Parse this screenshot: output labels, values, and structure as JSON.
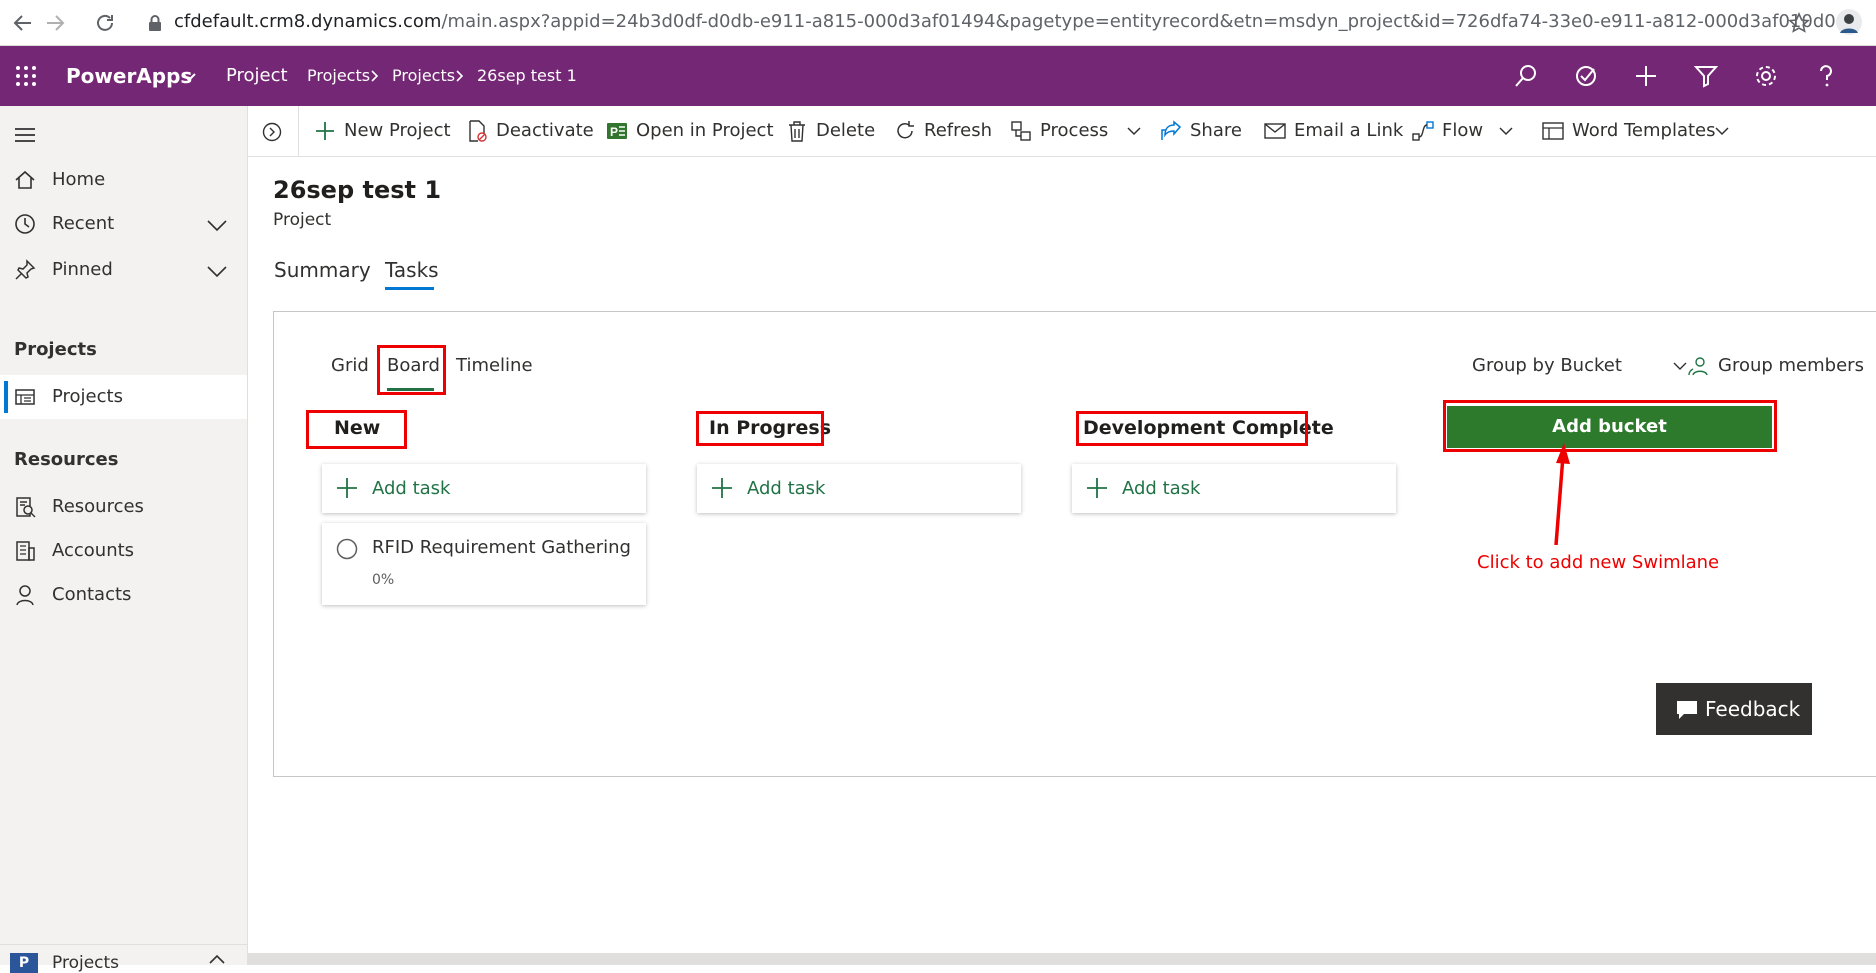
{
  "browser": {
    "url_domain": "cfdefault.crm8.dynamics.com",
    "url_path": "/main.aspx?appid=24b3d0df-d0db-e911-a815-000d3af01494&pagetype=entityrecord&etn=msdyn_project&id=726dfa74-33e0-e911-a812-000d3af010d0"
  },
  "topbar": {
    "app_name": "PowerApps",
    "module": "Project",
    "breadcrumb": [
      "Projects",
      "Projects",
      "26sep test 1"
    ],
    "icons": [
      "search-icon",
      "task-check-icon",
      "plus-icon",
      "filter-icon",
      "gear-icon",
      "help-icon"
    ]
  },
  "sidebar": {
    "items": [
      {
        "label": "Home",
        "icon": "home-icon"
      },
      {
        "label": "Recent",
        "icon": "clock-icon"
      },
      {
        "label": "Pinned",
        "icon": "pin-icon"
      }
    ],
    "section_projects": "Projects",
    "projects_item": "Projects",
    "section_resources": "Resources",
    "resources_items": [
      {
        "label": "Resources",
        "icon": "resources-icon"
      },
      {
        "label": "Accounts",
        "icon": "accounts-icon"
      },
      {
        "label": "Contacts",
        "icon": "contact-icon"
      }
    ],
    "area_switcher": {
      "letter": "P",
      "label": "Projects"
    }
  },
  "commands": [
    "New Project",
    "Deactivate",
    "Open in Project",
    "Delete",
    "Refresh",
    "Process",
    "Share",
    "Email a Link",
    "Flow",
    "Word Templates"
  ],
  "record": {
    "title": "26sep test 1",
    "type": "Project"
  },
  "tabs": [
    "Summary",
    "Tasks"
  ],
  "views": [
    "Grid",
    "Board",
    "Timeline"
  ],
  "group_by": "Group by Bucket",
  "group_members": "Group members",
  "buckets": [
    {
      "title": "New",
      "add_task": "Add task"
    },
    {
      "title": "In Progress",
      "add_task": "Add task"
    },
    {
      "title": "Development Complete",
      "add_task": "Add task"
    }
  ],
  "task": {
    "name": "RFID Requirement Gathering",
    "progress": "0%"
  },
  "add_bucket": "Add bucket",
  "annotation": "Click to add new Swimlane",
  "feedback": "Feedback",
  "colors": {
    "brand": "#742774",
    "accent_green": "#217346",
    "annotation_red": "#ee0000"
  }
}
